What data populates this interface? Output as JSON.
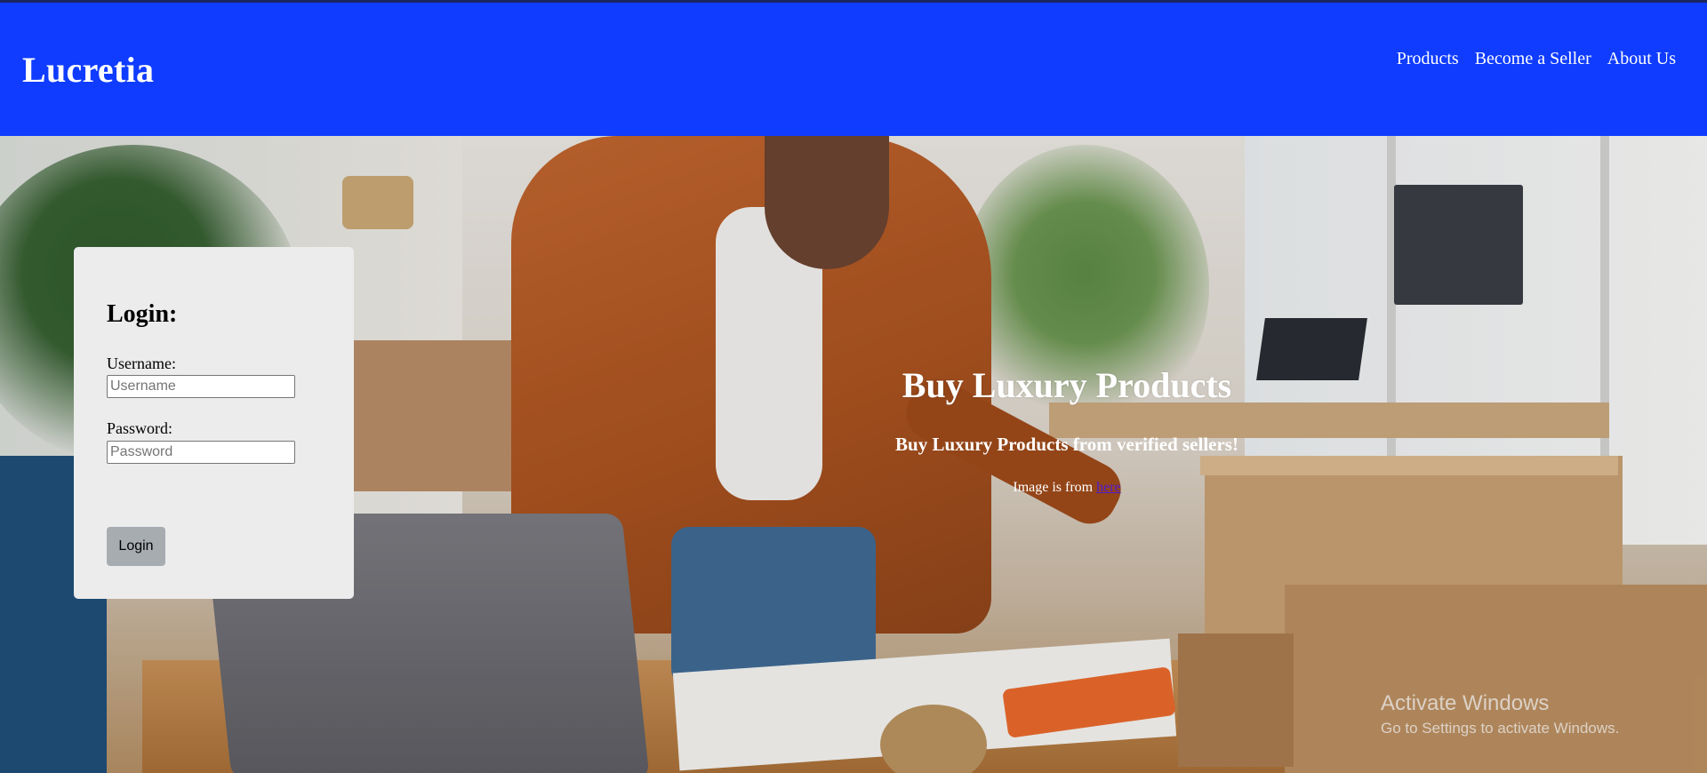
{
  "header": {
    "brand": "Lucretia",
    "nav": [
      {
        "label": "Products"
      },
      {
        "label": "Become a Seller"
      },
      {
        "label": "About Us"
      }
    ],
    "background_color": "#0f3cff"
  },
  "login": {
    "title": "Login:",
    "username_label": "Username:",
    "username_placeholder": "Username",
    "username_value": "",
    "password_label": "Password:",
    "password_placeholder": "Password",
    "password_value": "",
    "button_label": "Login"
  },
  "hero": {
    "title": "Buy Luxury Products",
    "subtitle": "Buy Luxury Products from verified sellers!",
    "credit_prefix": "Image is from ",
    "credit_link": "here",
    "link_color": "#4d1ad3"
  },
  "watermark": {
    "line1": "Activate Windows",
    "line2": "Go to Settings to activate Windows."
  }
}
